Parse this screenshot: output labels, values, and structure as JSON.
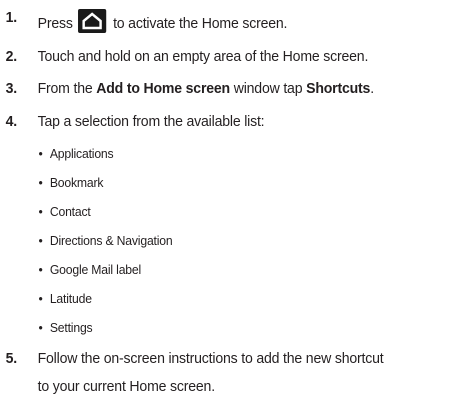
{
  "steps": [
    {
      "number": "1.",
      "before": "Press",
      "after": "to activate the Home screen.",
      "key_icon": "home-key-icon"
    },
    {
      "number": "2.",
      "text": "Touch and hold on an empty area of the Home screen."
    },
    {
      "number": "3.",
      "parts": [
        "From the ",
        "Add to Home screen",
        " window tap ",
        "Shortcuts",
        "."
      ]
    },
    {
      "number": "4.",
      "text": "Tap a selection from the available list:"
    },
    {
      "number": "5.",
      "line1": "Follow the on-screen instructions to add the new shortcut",
      "line2": "to your current Home screen."
    }
  ],
  "bullet_char": "•",
  "shortcuts": [
    "Applications",
    "Bookmark",
    "Contact",
    "Directions & Navigation",
    "Google Mail label",
    "Latitude",
    "Settings"
  ]
}
